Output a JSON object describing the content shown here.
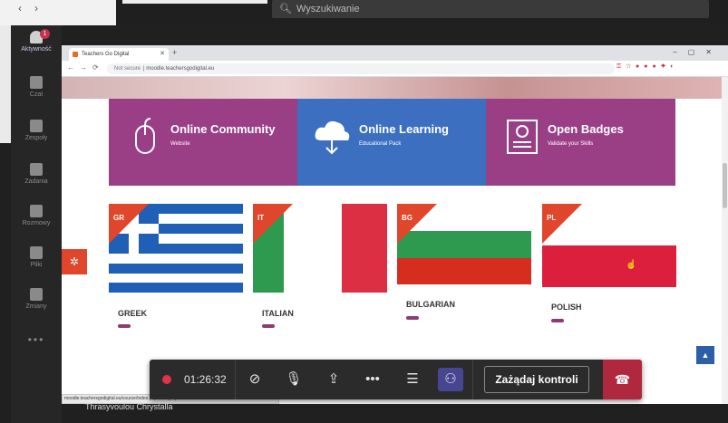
{
  "teams": {
    "search_placeholder": "Wyszukiwanie",
    "rail": [
      {
        "label": "Aktywność",
        "badge": "1",
        "active": true
      },
      {
        "label": "Czat"
      },
      {
        "label": "Zespoły"
      },
      {
        "label": "Zadania"
      },
      {
        "label": "Rozmowy"
      },
      {
        "label": "Pliki"
      },
      {
        "label": "Zmiany"
      }
    ],
    "more": "•••"
  },
  "browser": {
    "tab_title": "Teachers Go Digital",
    "address_prefix": "Not secure",
    "address": "moodle.teachersgodigital.eu",
    "status_url": "moodle.teachersgodigital.eu/course/index.php?categoryid=1"
  },
  "tiles": [
    {
      "title": "Online Community",
      "subtitle": "Website",
      "icon": "mouse-icon",
      "color": "#9a3f86"
    },
    {
      "title": "Online Learning",
      "subtitle": "Educational Pack",
      "icon": "cloud-download-icon",
      "color": "#3c6fbf"
    },
    {
      "title": "Open Badges",
      "subtitle": "Validate your Skills",
      "icon": "certificate-icon",
      "color": "#9a3f86"
    }
  ],
  "languages": [
    {
      "code": "GR",
      "name": "GREEK"
    },
    {
      "code": "IT",
      "name": "ITALIAN"
    },
    {
      "code": "",
      "name": ""
    },
    {
      "code": "BG",
      "name": "BULGARIAN"
    },
    {
      "code": "PL",
      "name": "POLISH"
    }
  ],
  "meeting": {
    "timer": "01:26:32",
    "request_control": "Zażądaj kontroli"
  },
  "caption": "Thrasyvoulou Chrystalla",
  "colors": {
    "accent_orange": "#e0462b",
    "purple": "#9a3f86",
    "blue": "#3c6fbf",
    "teams_purple": "#474791",
    "hangup": "#b0283d"
  }
}
